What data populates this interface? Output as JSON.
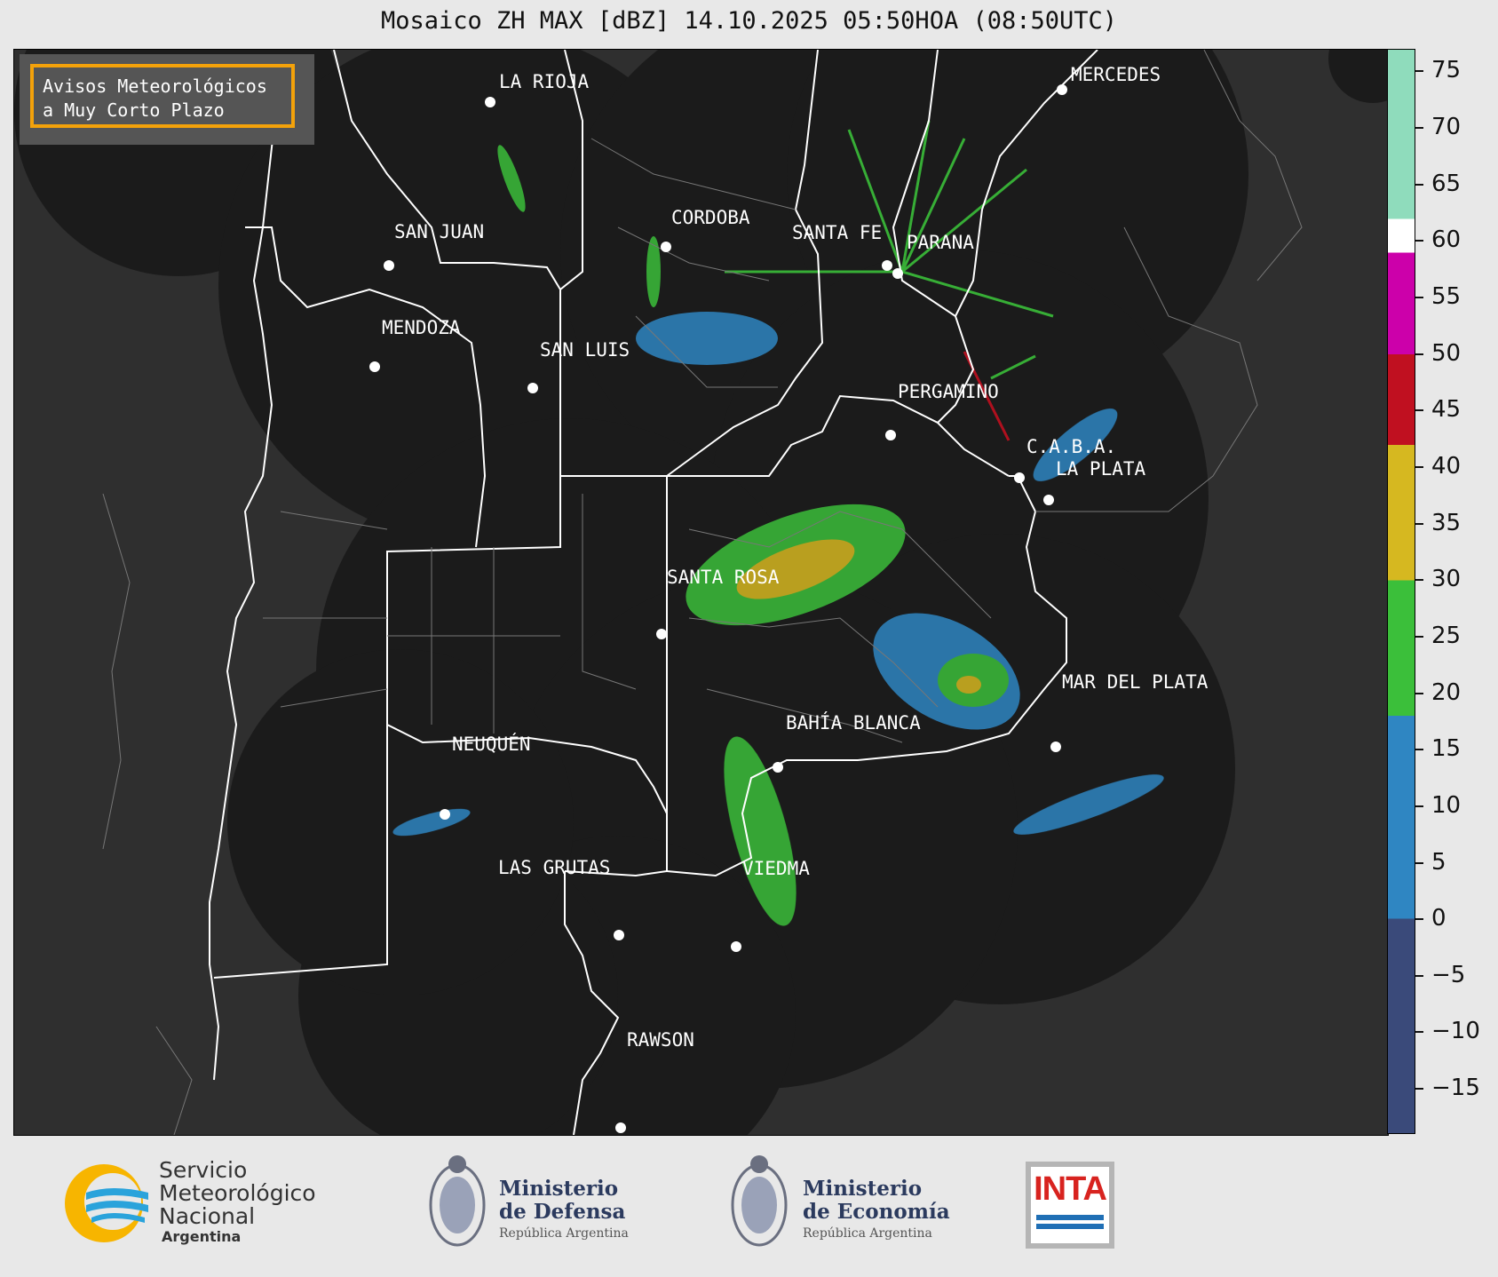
{
  "title": "Mosaico ZH MAX [dBZ] 14.10.2025 05:50HOA (08:50UTC)",
  "notice": {
    "line1": "Avisos Meteorológicos",
    "line2": "a Muy Corto Plazo",
    "border_color": "#f4a20a"
  },
  "cities": [
    {
      "name": "LA RIOJA"
    },
    {
      "name": "MERCEDES"
    },
    {
      "name": "SAN JUAN"
    },
    {
      "name": "CORDOBA"
    },
    {
      "name": "SANTA FE"
    },
    {
      "name": "PARANA"
    },
    {
      "name": "MENDOZA"
    },
    {
      "name": "SAN LUIS"
    },
    {
      "name": "PERGAMINO"
    },
    {
      "name": "C.A.B.A."
    },
    {
      "name": "LA PLATA"
    },
    {
      "name": "SANTA ROSA"
    },
    {
      "name": "MAR DEL PLATA"
    },
    {
      "name": "BAHÍA BLANCA"
    },
    {
      "name": "NEUQUÉN"
    },
    {
      "name": "LAS GRUTAS"
    },
    {
      "name": "VIEDMA"
    },
    {
      "name": "RAWSON"
    }
  ],
  "colorbar": {
    "unit": "dBZ",
    "min": -19,
    "max": 77,
    "ticks": [
      "75",
      "70",
      "65",
      "60",
      "55",
      "50",
      "45",
      "40",
      "35",
      "30",
      "25",
      "20",
      "15",
      "10",
      "5",
      "0",
      "−5",
      "−10",
      "−15"
    ],
    "bands": [
      {
        "from": -19,
        "to": 0,
        "color": "#3a4a7a"
      },
      {
        "from": 0,
        "to": 18,
        "color": "#2f86c2"
      },
      {
        "from": 18,
        "to": 30,
        "color": "#3bbf3a"
      },
      {
        "from": 30,
        "to": 42,
        "color": "#d6b820"
      },
      {
        "from": 42,
        "to": 50,
        "color": "#c01020"
      },
      {
        "from": 50,
        "to": 59,
        "color": "#cc00aa"
      },
      {
        "from": 59,
        "to": 62,
        "color": "#ffffff"
      },
      {
        "from": 62,
        "to": 77,
        "color": "#8fdcbc"
      }
    ]
  },
  "logos": {
    "smn": {
      "line1": "Servicio",
      "line2": "Meteorológico",
      "line3": "Nacional",
      "line4": "Argentina"
    },
    "defensa": {
      "line1": "Ministerio",
      "line2": "de Defensa",
      "line3": "República Argentina"
    },
    "economia": {
      "line1": "Ministerio",
      "line2": "de Economía",
      "line3": "República Argentina"
    },
    "inta": {
      "text": "INTA"
    }
  },
  "colors": {
    "map_bg": "#2f2f2f",
    "radar_disc": "#1b1b1b",
    "boundary": "#ffffff"
  }
}
